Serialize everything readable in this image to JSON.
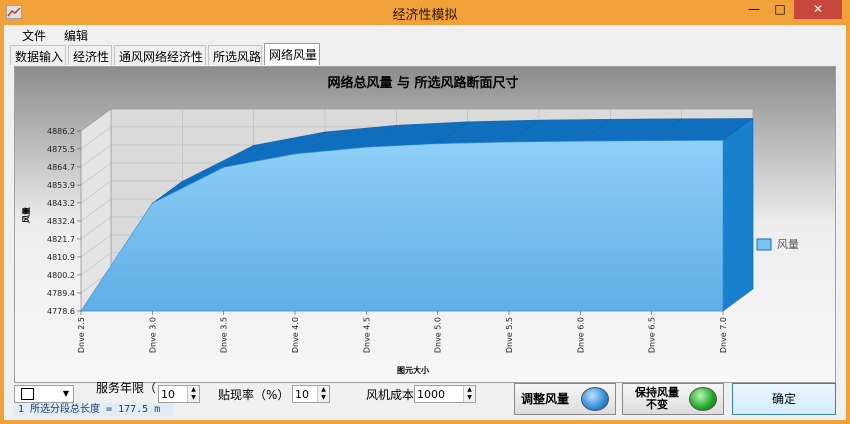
{
  "window": {
    "title": "经济性模拟",
    "minimize_glyph": "—",
    "maximize_glyph": "□",
    "close_glyph": "✕"
  },
  "menu": [
    "文件",
    "编辑"
  ],
  "tabs": [
    "数据输入",
    "经济性",
    "通风网络经济性",
    "所选风路",
    "网络风量"
  ],
  "active_tab": "网络风量",
  "chart_data": {
    "type": "area",
    "title": "网络总风量 与 所选风路断面尺寸",
    "xlabel": "图元大小",
    "ylabel": "风量",
    "categories": [
      "Dnve 2.5",
      "Dnve 3.0",
      "Dnve 3.5",
      "Dnve 4.0",
      "Dnve 4.5",
      "Dnve 5.0",
      "Dnve 5.5",
      "Dnve 6.0",
      "Dnve 6.5",
      "Dnve 7.0"
    ],
    "x": [
      2.5,
      3.0,
      3.5,
      4.0,
      4.5,
      5.0,
      5.5,
      6.0,
      6.5,
      7.0
    ],
    "yticks": [
      4778.6,
      4789.4,
      4800.2,
      4810.9,
      4821.7,
      4832.4,
      4843.2,
      4853.9,
      4864.7,
      4875.5,
      4886.2
    ],
    "ylim": [
      4778.6,
      4886.2
    ],
    "series": [
      {
        "name": "风量",
        "values": [
          4778.6,
          4843.0,
          4864.5,
          4872.5,
          4876.5,
          4878.6,
          4879.6,
          4880.1,
          4880.4,
          4880.6
        ]
      }
    ],
    "legend_position": "right",
    "three_d": true,
    "grid": true,
    "colors": {
      "front": "#7ec3ef",
      "top": "#0f6fbe",
      "side": "#1880cc",
      "back_wall": "#dadada",
      "floor": "#cfcfcf"
    }
  },
  "controls": {
    "line_color_swatch": "#ffffff",
    "service_years": {
      "label": "服务年限（",
      "value": "10"
    },
    "discount_rate": {
      "label": "贴现率（%）",
      "value": "10"
    },
    "fan_cost": {
      "label": "风机成本",
      "value": "1000"
    },
    "status": "1 所选分段总长度 = 177.5 m",
    "adjust_airflow_button": "调整风量",
    "keep_airflow_button": [
      "保持风量",
      "不变"
    ],
    "ok_button": "确定",
    "lamp_colors": {
      "adjust": "#2f8ad8",
      "keep": "#1fa526"
    }
  }
}
